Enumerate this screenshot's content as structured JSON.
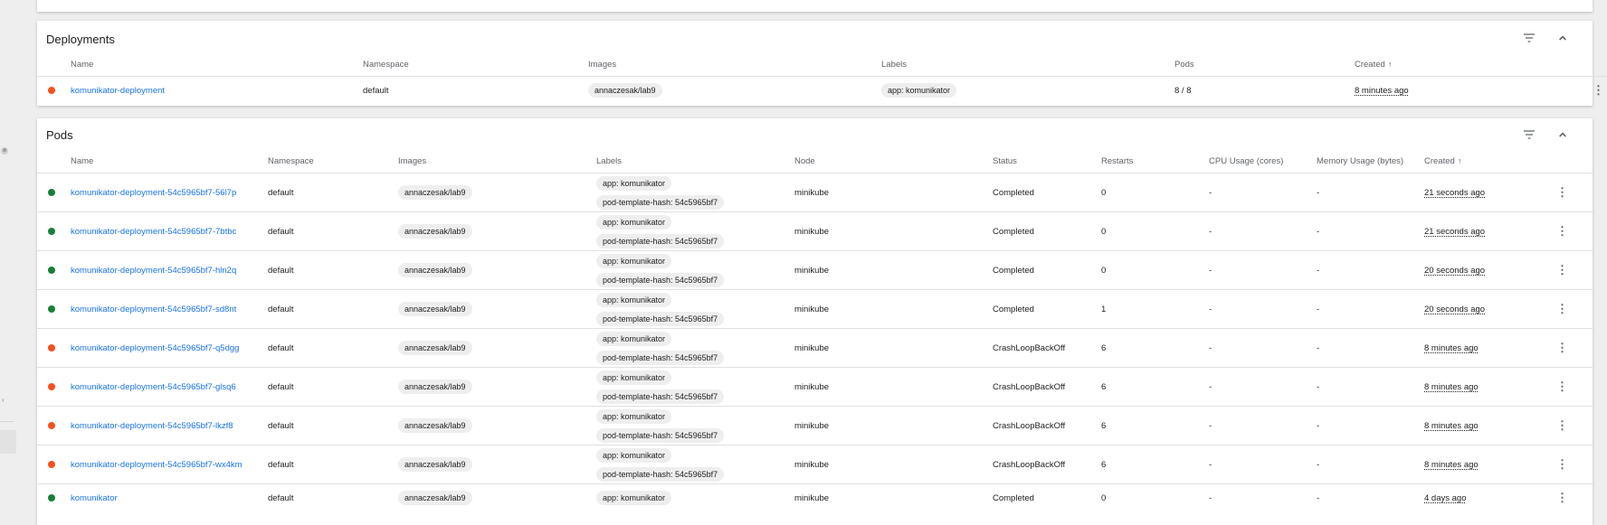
{
  "deployments": {
    "title": "Deployments",
    "columns": [
      "Name",
      "Namespace",
      "Images",
      "Labels",
      "Pods",
      "Created"
    ],
    "sort_arrow": "↑",
    "rows": [
      {
        "status": "failed",
        "name": "komunikator-deployment",
        "namespace": "default",
        "image": "annaczesak/lab9",
        "label": "app: komunikator",
        "pods": "8 / 8",
        "created": "8 minutes ago"
      }
    ]
  },
  "pods": {
    "title": "Pods",
    "columns": [
      "Name",
      "Namespace",
      "Images",
      "Labels",
      "Node",
      "Status",
      "Restarts",
      "CPU Usage (cores)",
      "Memory Usage (bytes)",
      "Created"
    ],
    "sort_arrow": "↑",
    "rows": [
      {
        "status": "ok",
        "name": "komunikator-deployment-54c5965bf7-56l7p",
        "namespace": "default",
        "image": "annaczesak/lab9",
        "label1": "app: komunikator",
        "label2": "pod-template-hash: 54c5965bf7",
        "node": "minikube",
        "state": "Completed",
        "restarts": "0",
        "cpu": "-",
        "memory": "-",
        "created": "21 seconds ago"
      },
      {
        "status": "ok",
        "name": "komunikator-deployment-54c5965bf7-7btbc",
        "namespace": "default",
        "image": "annaczesak/lab9",
        "label1": "app: komunikator",
        "label2": "pod-template-hash: 54c5965bf7",
        "node": "minikube",
        "state": "Completed",
        "restarts": "0",
        "cpu": "-",
        "memory": "-",
        "created": "21 seconds ago"
      },
      {
        "status": "ok",
        "name": "komunikator-deployment-54c5965bf7-hln2q",
        "namespace": "default",
        "image": "annaczesak/lab9",
        "label1": "app: komunikator",
        "label2": "pod-template-hash: 54c5965bf7",
        "node": "minikube",
        "state": "Completed",
        "restarts": "0",
        "cpu": "-",
        "memory": "-",
        "created": "20 seconds ago"
      },
      {
        "status": "ok",
        "name": "komunikator-deployment-54c5965bf7-sd8nt",
        "namespace": "default",
        "image": "annaczesak/lab9",
        "label1": "app: komunikator",
        "label2": "pod-template-hash: 54c5965bf7",
        "node": "minikube",
        "state": "Completed",
        "restarts": "1",
        "cpu": "-",
        "memory": "-",
        "created": "20 seconds ago"
      },
      {
        "status": "failed",
        "name": "komunikator-deployment-54c5965bf7-q5dgg",
        "namespace": "default",
        "image": "annaczesak/lab9",
        "label1": "app: komunikator",
        "label2": "pod-template-hash: 54c5965bf7",
        "node": "minikube",
        "state": "CrashLoopBackOff",
        "restarts": "6",
        "cpu": "-",
        "memory": "-",
        "created": "8 minutes ago"
      },
      {
        "status": "failed",
        "name": "komunikator-deployment-54c5965bf7-glsq6",
        "namespace": "default",
        "image": "annaczesak/lab9",
        "label1": "app: komunikator",
        "label2": "pod-template-hash: 54c5965bf7",
        "node": "minikube",
        "state": "CrashLoopBackOff",
        "restarts": "6",
        "cpu": "-",
        "memory": "-",
        "created": "8 minutes ago"
      },
      {
        "status": "failed",
        "name": "komunikator-deployment-54c5965bf7-lkzf8",
        "namespace": "default",
        "image": "annaczesak/lab9",
        "label1": "app: komunikator",
        "label2": "pod-template-hash: 54c5965bf7",
        "node": "minikube",
        "state": "CrashLoopBackOff",
        "restarts": "6",
        "cpu": "-",
        "memory": "-",
        "created": "8 minutes ago"
      },
      {
        "status": "failed",
        "name": "komunikator-deployment-54c5965bf7-wx4km",
        "namespace": "default",
        "image": "annaczesak/lab9",
        "label1": "app: komunikator",
        "label2": "pod-template-hash: 54c5965bf7",
        "node": "minikube",
        "state": "CrashLoopBackOff",
        "restarts": "6",
        "cpu": "-",
        "memory": "-",
        "created": "8 minutes ago"
      },
      {
        "status": "ok",
        "name": "komunikator",
        "namespace": "default",
        "image": "annaczesak/lab9",
        "label1": "app: komunikator",
        "label2": "",
        "node": "minikube",
        "state": "Completed",
        "restarts": "0",
        "cpu": "-",
        "memory": "-",
        "created": "4 days ago"
      }
    ]
  },
  "icons": {
    "filter": "filter-icon",
    "collapse": "chevron-up-icon",
    "row_menu": "more-vert-icon"
  },
  "colors": {
    "ok": "#188038",
    "failed": "#f4511e",
    "link": "#1a73e8"
  }
}
